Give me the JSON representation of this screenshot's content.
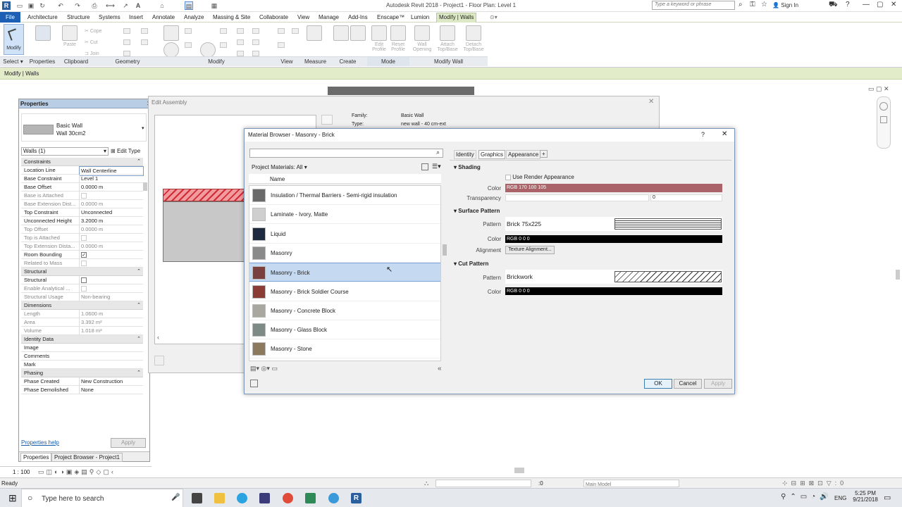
{
  "window": {
    "title": "Autodesk Revit 2018 -  Project1 - Floor Plan: Level 1",
    "search_placeholder": "Type a keyword or phrase",
    "sign_in": "Sign In"
  },
  "tabs": [
    "File",
    "Architecture",
    "Structure",
    "Systems",
    "Insert",
    "Annotate",
    "Analyze",
    "Massing & Site",
    "Collaborate",
    "View",
    "Manage",
    "Add-Ins",
    "Enscape™",
    "Lumion",
    "Modify | Walls"
  ],
  "ribbon": {
    "modify_label": "Modify",
    "panels": [
      "Select ▾",
      "Properties",
      "Clipboard",
      "Geometry",
      "Modify",
      "View",
      "Measure",
      "Create",
      "Mode",
      "Modify Wall"
    ],
    "tools": {
      "paste": "Paste",
      "cope": "Cope",
      "cut": "Cut",
      "join": "Join",
      "edit_profile": "Edit Profile",
      "reset_profile": "Reset Profile",
      "wall_opening": "Wall Opening",
      "attach": "Attach Top/Base",
      "detach": "Detach Top/Base"
    }
  },
  "context_bar": "Modify | Walls",
  "properties": {
    "title": "Properties",
    "type_family": "Basic Wall",
    "type_name": "Wall 30cm2",
    "selector": "Walls (1)",
    "edit_type": "Edit Type",
    "groups": {
      "constraints": "Constraints",
      "structural": "Structural",
      "dimensions": "Dimensions",
      "identity": "Identity Data",
      "phasing": "Phasing"
    },
    "rows": {
      "location_line": {
        "k": "Location Line",
        "v": "Wall Centerline"
      },
      "base_constraint": {
        "k": "Base Constraint",
        "v": "Level 1"
      },
      "base_offset": {
        "k": "Base Offset",
        "v": "0.0000 m"
      },
      "base_attached": {
        "k": "Base is Attached",
        "v": ""
      },
      "base_ext": {
        "k": "Base Extension Dist...",
        "v": "0.0000 m"
      },
      "top_constraint": {
        "k": "Top Constraint",
        "v": "Unconnected"
      },
      "unconnected_height": {
        "k": "Unconnected Height",
        "v": "3.2000 m"
      },
      "top_offset": {
        "k": "Top Offset",
        "v": "0.0000 m"
      },
      "top_attached": {
        "k": "Top is Attached",
        "v": ""
      },
      "top_ext": {
        "k": "Top Extension Dista...",
        "v": "0.0000 m"
      },
      "room_bounding": {
        "k": "Room Bounding",
        "v": "✓"
      },
      "related_mass": {
        "k": "Related to Mass",
        "v": ""
      },
      "structural": {
        "k": "Structural",
        "v": ""
      },
      "enable_analytical": {
        "k": "Enable Analytical ...",
        "v": ""
      },
      "structural_usage": {
        "k": "Structural Usage",
        "v": "Non-bearing"
      },
      "length": {
        "k": "Length",
        "v": "1.0600 m"
      },
      "area": {
        "k": "Area",
        "v": "3.392 m²"
      },
      "volume": {
        "k": "Volume",
        "v": "1.018 m³"
      },
      "image": {
        "k": "Image",
        "v": ""
      },
      "comments": {
        "k": "Comments",
        "v": ""
      },
      "mark": {
        "k": "Mark",
        "v": ""
      },
      "phase_created": {
        "k": "Phase Created",
        "v": "New Construction"
      },
      "phase_demolished": {
        "k": "Phase Demolished",
        "v": "None"
      }
    },
    "help": "Properties help",
    "apply": "Apply",
    "bottom_tabs": [
      "Properties",
      "Project Browser - Project1"
    ]
  },
  "edit_assembly": {
    "title": "Edit Assembly",
    "family_label": "Family:",
    "family_value": "Basic Wall",
    "type_label": "Type:",
    "type_value": "new wall - 40 cm-ext"
  },
  "material_browser": {
    "title": "Material Browser - Masonry - Brick",
    "filter": "Project Materials: All",
    "col_name": "Name",
    "materials": [
      {
        "name": "Insulation / Thermal Barriers - Semi-rigid insulation",
        "color": "#6a6a6a"
      },
      {
        "name": "Laminate - Ivory, Matte",
        "color": "#cfcfcf"
      },
      {
        "name": "Liquid",
        "color": "#1e2a40"
      },
      {
        "name": "Masonry",
        "color": "#8a8a8a"
      },
      {
        "name": "Masonry - Brick",
        "color": "#7a3f3f"
      },
      {
        "name": "Masonry - Brick Soldier Course",
        "color": "#8a3c35"
      },
      {
        "name": "Masonry - Concrete Block",
        "color": "#a8a8a0"
      },
      {
        "name": "Masonry - Glass Block",
        "color": "#7d8a86"
      },
      {
        "name": "Masonry - Stone",
        "color": "#8c7a5e"
      }
    ],
    "selected": 4,
    "tabs": [
      "Identity",
      "Graphics",
      "Appearance",
      "+"
    ],
    "shading": {
      "header": "Shading",
      "use_render": "Use Render Appearance",
      "color_label": "Color",
      "color_value": "RGB 170 100 105",
      "color_hex": "#aa6469",
      "transparency_label": "Transparency",
      "transparency_value": "0"
    },
    "surface": {
      "header": "Surface Pattern",
      "pattern_label": "Pattern",
      "pattern_value": "Brick 75x225",
      "color_label": "Color",
      "color_value": "RGB 0 0 0",
      "alignment_label": "Alignment",
      "alignment_value": "Texture Alignment..."
    },
    "cut": {
      "header": "Cut Pattern",
      "pattern_label": "Pattern",
      "pattern_value": "Brickwork",
      "color_label": "Color",
      "color_value": "RGB 0 0 0"
    },
    "ok": "OK",
    "cancel": "Cancel",
    "apply": "Apply",
    "help": "?"
  },
  "view_bar": {
    "scale": "1 : 100"
  },
  "status": {
    "text": "Ready",
    "coord": ":0",
    "model": "Main Model"
  },
  "taskbar": {
    "search": "Type here to search",
    "lang": "ENG",
    "time": "5:25 PM",
    "date": "9/21/2018"
  },
  "colors": {
    "accent": "#1d5fb4",
    "context": "#e3ecc9",
    "selected": "#c5d9f1"
  }
}
